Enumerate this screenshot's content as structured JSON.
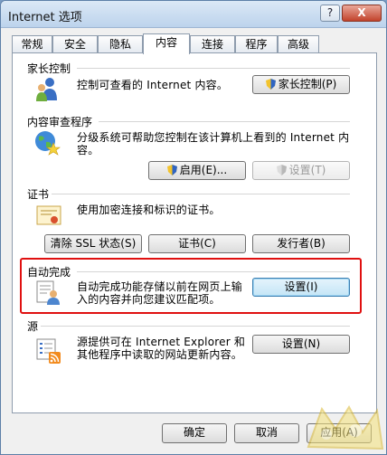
{
  "window": {
    "title": "Internet 选项",
    "help_label": "?",
    "close_label": "X"
  },
  "tabs": [
    {
      "label": "常规"
    },
    {
      "label": "安全"
    },
    {
      "label": "隐私"
    },
    {
      "label": "内容"
    },
    {
      "label": "连接"
    },
    {
      "label": "程序"
    },
    {
      "label": "高级"
    }
  ],
  "active_tab": "内容",
  "parental": {
    "title": "家长控制",
    "description": "控制可查看的 Internet 内容。",
    "button_label": "家长控制(P)"
  },
  "advisor": {
    "title": "内容审查程序",
    "description_line1": "分级系统可帮助您控制在该计算机上看到的 Internet 内",
    "description_line2": "容。",
    "enable_label": "启用(E)...",
    "settings_label": "设置(T)"
  },
  "certificates": {
    "title": "证书",
    "description": "使用加密连接和标识的证书。",
    "clear_ssl_label": "清除 SSL 状态(S)",
    "certs_label": "证书(C)",
    "publishers_label": "发行者(B)"
  },
  "autocomplete": {
    "title": "自动完成",
    "description_line1": "自动完成功能存储以前在网页上输",
    "description_line2": "入的内容并向您建议匹配项。",
    "settings_label": "设置(I)"
  },
  "feeds": {
    "title": "源",
    "description_line1": "源提供可在 Internet Explorer 和",
    "description_line2": "其他程序中读取的网站更新内容。",
    "settings_label": "设置(N)"
  },
  "dialog_buttons": {
    "ok": "确定",
    "cancel": "取消",
    "apply": "应用(A)"
  },
  "colors": {
    "highlight_border": "#e01010",
    "titlebar": "#c9dcf0",
    "focus_button": "#c4e5f6"
  }
}
